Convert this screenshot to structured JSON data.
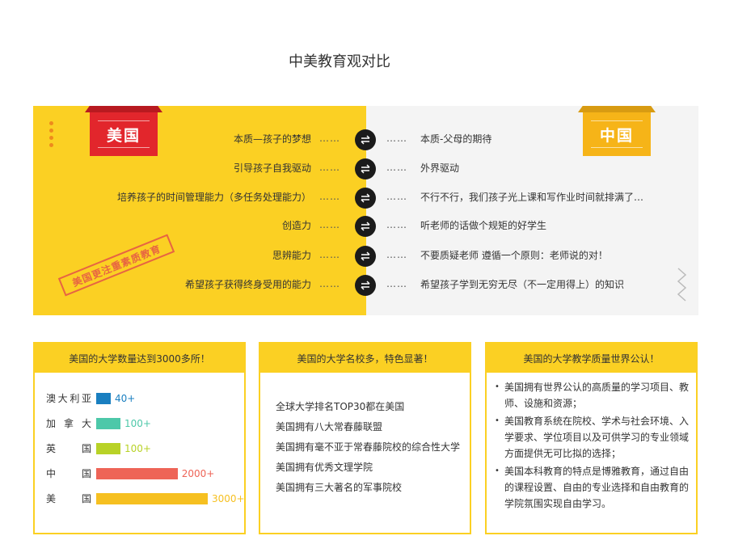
{
  "title": "中美教育观对比",
  "comparison": {
    "us_flag": "美国",
    "cn_flag": "中国",
    "stamp": "美国更注重素质教育",
    "leader_dots": "……",
    "rows": [
      {
        "us": "本质—孩子的梦想",
        "cn": "本质-父母的期待"
      },
      {
        "us": "引导孩子自我驱动",
        "cn": "外界驱动"
      },
      {
        "us": "培养孩子的时间管理能力（多任务处理能力）",
        "cn": "不行不行，我们孩子光上课和写作业时间就排满了…"
      },
      {
        "us": "创造力",
        "cn": "听老师的话做个规矩的好学生"
      },
      {
        "us": "思辨能力",
        "cn": "不要质疑老师 遵循一个原则：老师说的对！"
      },
      {
        "us": "希望孩子获得终身受用的能力",
        "cn": "希望孩子学到无穷无尽（不一定用得上）的知识"
      }
    ]
  },
  "card_universities": {
    "header": "美国的大学数量达到3000多所！",
    "bars": [
      {
        "label": [
          "澳",
          "大",
          "利",
          "亚"
        ],
        "value": 40,
        "value_label": "40+",
        "color": "#1a7fc0"
      },
      {
        "label": [
          "加",
          "拿",
          "大"
        ],
        "value": 100,
        "value_label": "100+",
        "color": "#4dc8a9"
      },
      {
        "label": [
          "英",
          "国"
        ],
        "value": 100,
        "value_label": "100+",
        "color": "#b8d227"
      },
      {
        "label": [
          "中",
          "国"
        ],
        "value": 2000,
        "value_label": "2000+",
        "color": "#ee6457"
      },
      {
        "label": [
          "美",
          "国"
        ],
        "value": 3000,
        "value_label": "3000+",
        "color": "#f6c021"
      }
    ]
  },
  "card_schools": {
    "header": "美国的大学名校多，特色显著！",
    "items": [
      "全球大学排名TOP30都在美国",
      "美国拥有八大常春藤联盟",
      "美国拥有毫不亚于常春藤院校的综合性大学",
      "美国拥有优秀文理学院",
      "美国拥有三大著名的军事院校"
    ]
  },
  "card_quality": {
    "header": "美国的大学教学质量世界公认！",
    "items": [
      "美国拥有世界公认的高质量的学习项目、教师、设施和资源；",
      "美国教育系统在院校、学术与社会环境、入学要求、学位项目以及可供学习的专业领域方面提供无可比拟的选择；",
      "美国本科教育的特点是博雅教育，通过自由的课程设置、自由的专业选择和自由教育的学院氛围实现自由学习。"
    ]
  },
  "colors": {
    "yellow": "#fbd023",
    "us_red": "#e2262c",
    "cn_gold": "#f6b418",
    "grey_panel": "#f4f4f4"
  }
}
